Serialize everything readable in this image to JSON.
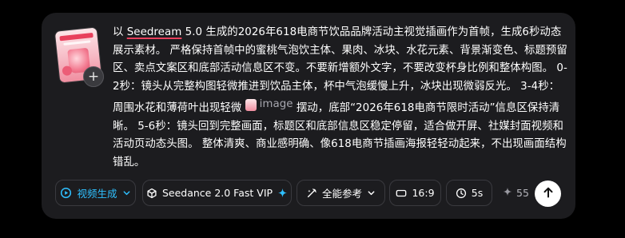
{
  "composer": {
    "prompt_segments": {
      "p1": "以 ",
      "p2": "Seedream",
      "p3": " 5.0 生成的2026年618电商节饮品品牌活动主视觉插画作为首帧，生成6秒动态展示素材。 严格保持首帧中的蜜桃气泡饮主体、果肉、冰块、水花元素、背景渐变色、标题预留区、卖点文案区和底部活动信息区不变。不要新增额外文字，不要改变杯身比例和整体构图。 0-2秒：镜头从完整构图轻微推进到饮品主体，杯中气泡缓慢上升，冰块出现微弱反光。 3-4秒：周围水花和薄荷叶出现轻微 ",
      "image_ref": "image",
      "p4": " 摆动，底部“2026年618电商节限时活动”信息区保持清晰。 5-6秒：镜头回到完整画面，标题区和底部信息区稳定停留，适合做开屏、社媒封面视频和活动页动态头图。 整体清爽、商业感明确、像618电商节插画海报轻轻动起来，不出现画面结构错乱。"
    },
    "add_button_label": "+",
    "toolbar": {
      "mode_label": "视频生成",
      "model_label": "Seedance 2.0 Fast VIP",
      "reference_label": "全能参考",
      "ratio_label": "16:9",
      "duration_label": "5s",
      "cost_value": "55"
    },
    "icons": {
      "mode": "video-play-icon",
      "mode_chevron": "chevron-down-icon",
      "model": "cube-icon",
      "model_badge": "sparkle-icon",
      "reference": "magic-reference-icon",
      "reference_chevron": "chevron-down-icon",
      "ratio": "aspect-ratio-icon",
      "duration": "clock-icon",
      "cost": "sparkle-icon",
      "send": "arrow-up-icon"
    },
    "colors": {
      "accent": "#2fc0ff",
      "card_background": "#1c1c1f",
      "page_background": "#000000",
      "send_button": "#ffffff"
    }
  }
}
